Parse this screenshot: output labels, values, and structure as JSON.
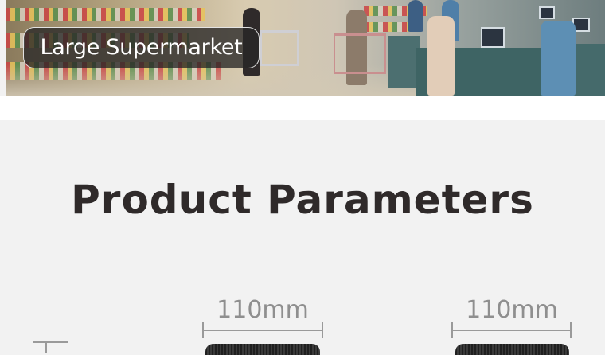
{
  "banner": {
    "label": "Large Supermarket"
  },
  "parameters": {
    "title": "Product Parameters",
    "dimensions": [
      {
        "label": "110mm"
      },
      {
        "label": "110mm"
      }
    ]
  }
}
